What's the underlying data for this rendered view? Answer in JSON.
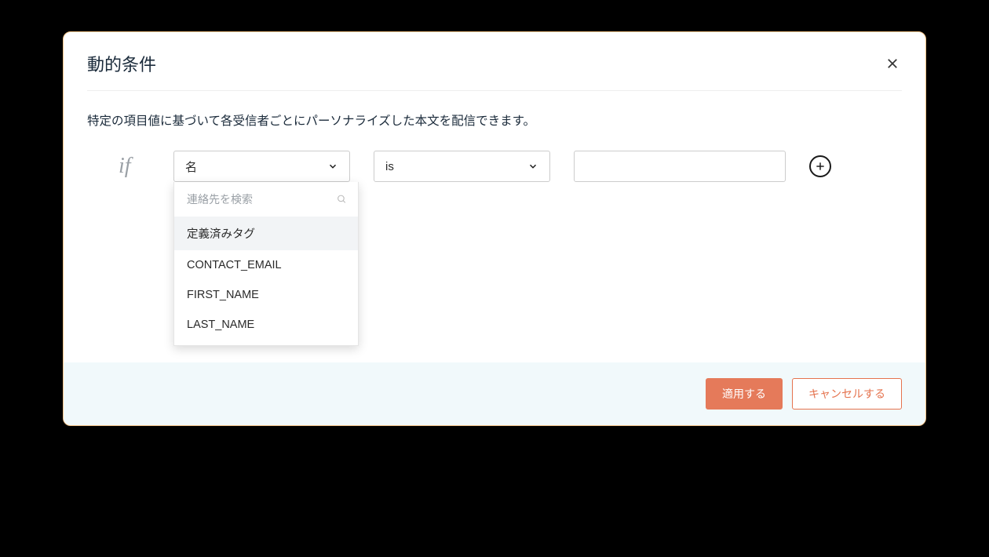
{
  "modal": {
    "title": "動的条件",
    "description": "特定の項目値に基づいて各受信者ごとにパーソナライズした本文を配信できます。"
  },
  "condition": {
    "if_label": "if",
    "field_select": {
      "value": "名"
    },
    "operator_select": {
      "value": "is"
    },
    "value_input": {
      "value": "",
      "placeholder": ""
    }
  },
  "dropdown": {
    "search_placeholder": "連絡先を検索",
    "group_header": "定義済みタグ",
    "items": [
      "CONTACT_EMAIL",
      "FIRST_NAME",
      "LAST_NAME"
    ]
  },
  "footer": {
    "apply": "適用する",
    "cancel": "キャンセルする"
  }
}
